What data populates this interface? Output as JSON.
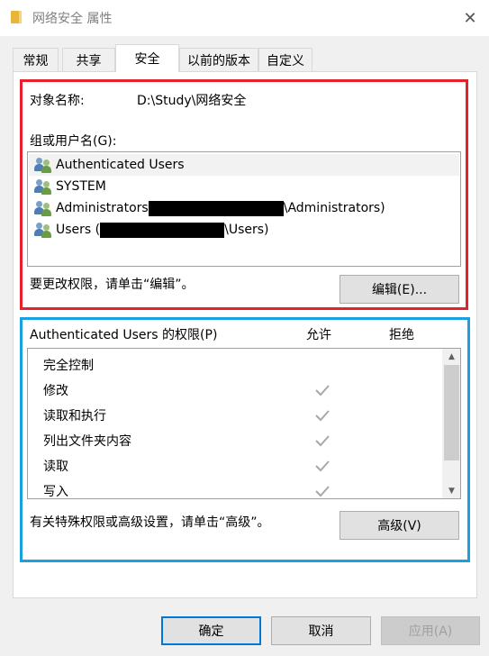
{
  "window": {
    "title": "网络安全 属性",
    "close_glyph": "✕"
  },
  "tabs": [
    {
      "label": "常规",
      "active": false
    },
    {
      "label": "共享",
      "active": false
    },
    {
      "label": "安全",
      "active": true
    },
    {
      "label": "以前的版本",
      "active": false
    },
    {
      "label": "自定义",
      "active": false
    }
  ],
  "security": {
    "object_name_label": "对象名称:",
    "object_name_value": "D:\\Study\\网络安全",
    "group_label": "组或用户名(G):",
    "users": [
      {
        "prefix": "Authenticated Users",
        "suffix": "",
        "redacted": false,
        "selected": true,
        "icon": "users-group-icon"
      },
      {
        "prefix": "SYSTEM",
        "suffix": "",
        "redacted": false,
        "selected": false,
        "icon": "users-group-icon"
      },
      {
        "prefix": "Administrators",
        "suffix": "\\Administrators)",
        "redacted": true,
        "selected": false,
        "icon": "users-group-icon"
      },
      {
        "prefix": "Users (",
        "suffix": "\\Users)",
        "redacted": true,
        "selected": false,
        "icon": "users-group-icon"
      }
    ],
    "edit_hint": "要更改权限，请单击“编辑”。",
    "edit_button": "编辑(E)..."
  },
  "permissions": {
    "header": "Authenticated Users 的权限(P)",
    "allow_col": "允许",
    "deny_col": "拒绝",
    "rows": [
      {
        "name": "完全控制",
        "allow": false
      },
      {
        "name": "修改",
        "allow": true
      },
      {
        "name": "读取和执行",
        "allow": true
      },
      {
        "name": "列出文件夹内容",
        "allow": true
      },
      {
        "name": "读取",
        "allow": true
      },
      {
        "name": "写入",
        "allow": true
      }
    ],
    "advanced_hint": "有关特殊权限或高级设置，请单击“高级”。",
    "advanced_button": "高级(V)"
  },
  "footer": {
    "ok": "确定",
    "cancel": "取消",
    "apply": "应用(A)"
  },
  "colors": {
    "red_highlight": "#e8202a",
    "blue_highlight": "#1aa0e0",
    "check_gray": "#a8a8a8"
  }
}
